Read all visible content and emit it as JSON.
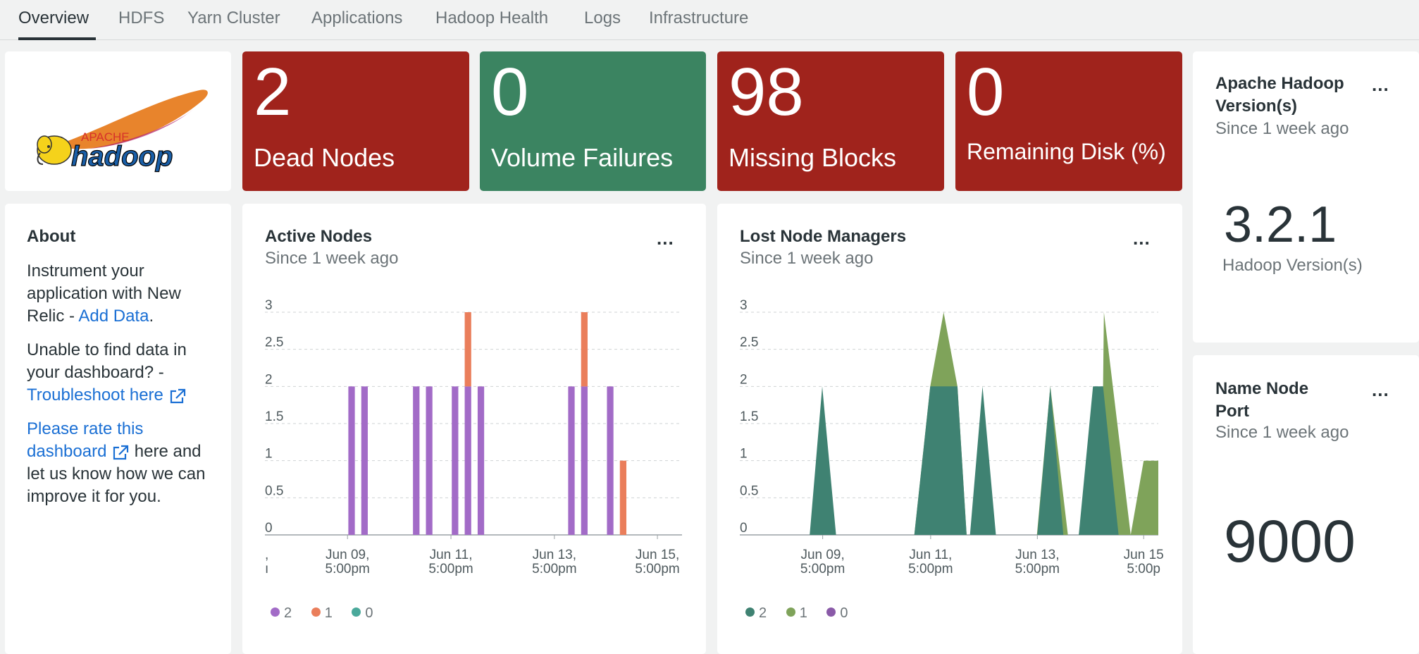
{
  "tabs": [
    {
      "label": "Overview",
      "active": true
    },
    {
      "label": "HDFS"
    },
    {
      "label": "Yarn Cluster"
    },
    {
      "label": "Applications"
    },
    {
      "label": "Hadoop Health"
    },
    {
      "label": "Logs"
    },
    {
      "label": "Infrastructure"
    }
  ],
  "logo": {
    "apache": "APACHE",
    "name": "hadoop"
  },
  "billboards": [
    {
      "value": "2",
      "label": "Dead Nodes",
      "status": "critical",
      "color": "#a0231c"
    },
    {
      "value": "0",
      "label": "Volume Failures",
      "status": "ok",
      "color": "#3b8461"
    },
    {
      "value": "98",
      "label": "Missing Blocks",
      "status": "critical",
      "color": "#a0231c"
    },
    {
      "value": "0",
      "label": "Remaining Disk (%)",
      "status": "critical",
      "color": "#a0231c"
    }
  ],
  "about": {
    "title": "About",
    "p1_text": "Instrument your application with New Relic - ",
    "p1_link": "Add Data",
    "p1_end": ".",
    "p2_text": "Unable to find data in your dashboard? - ",
    "p2_link": "Troubleshoot here",
    "p3_link": "Please rate this dashboard",
    "p3_text": " here and let us know how we can improve it for you."
  },
  "version_card": {
    "title": "Apache Hadoop Version(s)",
    "since": "Since 1 week ago",
    "value": "3.2.1",
    "label": "Hadoop Version(s)",
    "menu": "..."
  },
  "port_card": {
    "title": "Name Node Port",
    "since": "Since 1 week ago",
    "value": "9000",
    "menu": "..."
  },
  "chart_data": [
    {
      "type": "bar",
      "title": "Active Nodes",
      "subtitle": "Since 1 week ago",
      "menu": "...",
      "ylim": [
        0,
        3
      ],
      "y_ticks": [
        "0",
        "0.5",
        "1",
        "1.5",
        "2",
        "2.5",
        "3"
      ],
      "x_ticks": [
        {
          "t": 0.198,
          "l1": "Jun 09,",
          "l2": "5:00pm"
        },
        {
          "t": 0.446,
          "l1": "Jun 11,",
          "l2": "5:00pm"
        },
        {
          "t": 0.694,
          "l1": "Jun 13,",
          "l2": "5:00pm"
        },
        {
          "t": 0.941,
          "l1": "Jun 15,",
          "l2": "5:00pm"
        }
      ],
      "left_edge_ticks": [
        ",",
        "ı"
      ],
      "legend": [
        {
          "name": "2",
          "color": "#a26bc7"
        },
        {
          "name": "1",
          "color": "#ea7e5b"
        },
        {
          "name": "0",
          "color": "#4aa99b"
        }
      ],
      "grid": true,
      "bars": [
        {
          "t": 0.2,
          "w": 0.026,
          "values": [
            2,
            0
          ]
        },
        {
          "t": 0.231,
          "w": 0.026,
          "values": [
            2,
            0
          ]
        },
        {
          "t": 0.355,
          "w": 0.026,
          "values": [
            2,
            0
          ]
        },
        {
          "t": 0.386,
          "w": 0.026,
          "values": [
            2,
            0
          ]
        },
        {
          "t": 0.448,
          "w": 0.026,
          "values": [
            2,
            0
          ]
        },
        {
          "t": 0.479,
          "w": 0.026,
          "values": [
            2,
            1
          ]
        },
        {
          "t": 0.51,
          "w": 0.026,
          "values": [
            2,
            0
          ]
        },
        {
          "t": 0.727,
          "w": 0.026,
          "values": [
            2,
            0
          ]
        },
        {
          "t": 0.758,
          "w": 0.026,
          "values": [
            2,
            1
          ]
        },
        {
          "t": 0.82,
          "w": 0.026,
          "values": [
            2,
            0
          ]
        },
        {
          "t": 0.851,
          "w": 0.026,
          "values": [
            0,
            1
          ]
        }
      ]
    },
    {
      "type": "area",
      "title": "Lost Node Managers",
      "subtitle": "Since 1 week ago",
      "menu": "...",
      "ylim": [
        0,
        3
      ],
      "y_ticks": [
        "0",
        "0.5",
        "1",
        "1.5",
        "2",
        "2.5",
        "3"
      ],
      "x_ticks": [
        {
          "t": 0.198,
          "l1": "Jun 09,",
          "l2": "5:00pm"
        },
        {
          "t": 0.456,
          "l1": "Jun 11,",
          "l2": "5:00pm"
        },
        {
          "t": 0.711,
          "l1": "Jun 13,",
          "l2": "5:00pm"
        },
        {
          "t": 0.965,
          "l1": "Jun 15",
          "l2": "5:00p"
        }
      ],
      "legend": [
        {
          "name": "2",
          "color": "#3f8272"
        },
        {
          "name": "1",
          "color": "#7fa35a"
        },
        {
          "name": "0",
          "color": "#8a5aa8"
        }
      ],
      "grid": true,
      "series": [
        {
          "name": "1",
          "color": "#7fa35a",
          "points": [
            [
              0.417,
              0
            ],
            [
              0.455,
              2
            ],
            [
              0.487,
              3
            ],
            [
              0.52,
              2
            ],
            [
              0.542,
              0
            ],
            [
              0.71,
              0
            ],
            [
              0.742,
              2
            ],
            [
              0.784,
              0
            ],
            [
              0.81,
              0
            ],
            [
              0.868,
              2
            ],
            [
              0.87,
              3
            ],
            [
              0.934,
              0
            ],
            [
              0.965,
              1
            ],
            [
              1.0,
              1
            ],
            [
              1.0,
              0
            ]
          ]
        },
        {
          "name": "2",
          "color": "#3f8272",
          "points": [
            [
              0.167,
              0
            ],
            [
              0.197,
              2
            ],
            [
              0.23,
              0
            ],
            [
              0.417,
              0
            ],
            [
              0.455,
              2
            ],
            [
              0.52,
              2
            ],
            [
              0.542,
              0
            ],
            [
              0.55,
              0
            ],
            [
              0.58,
              2
            ],
            [
              0.612,
              0
            ],
            [
              0.711,
              0
            ],
            [
              0.742,
              2
            ],
            [
              0.773,
              0
            ],
            [
              0.81,
              0
            ],
            [
              0.844,
              2
            ],
            [
              0.868,
              2
            ],
            [
              0.905,
              0
            ]
          ]
        }
      ]
    }
  ]
}
